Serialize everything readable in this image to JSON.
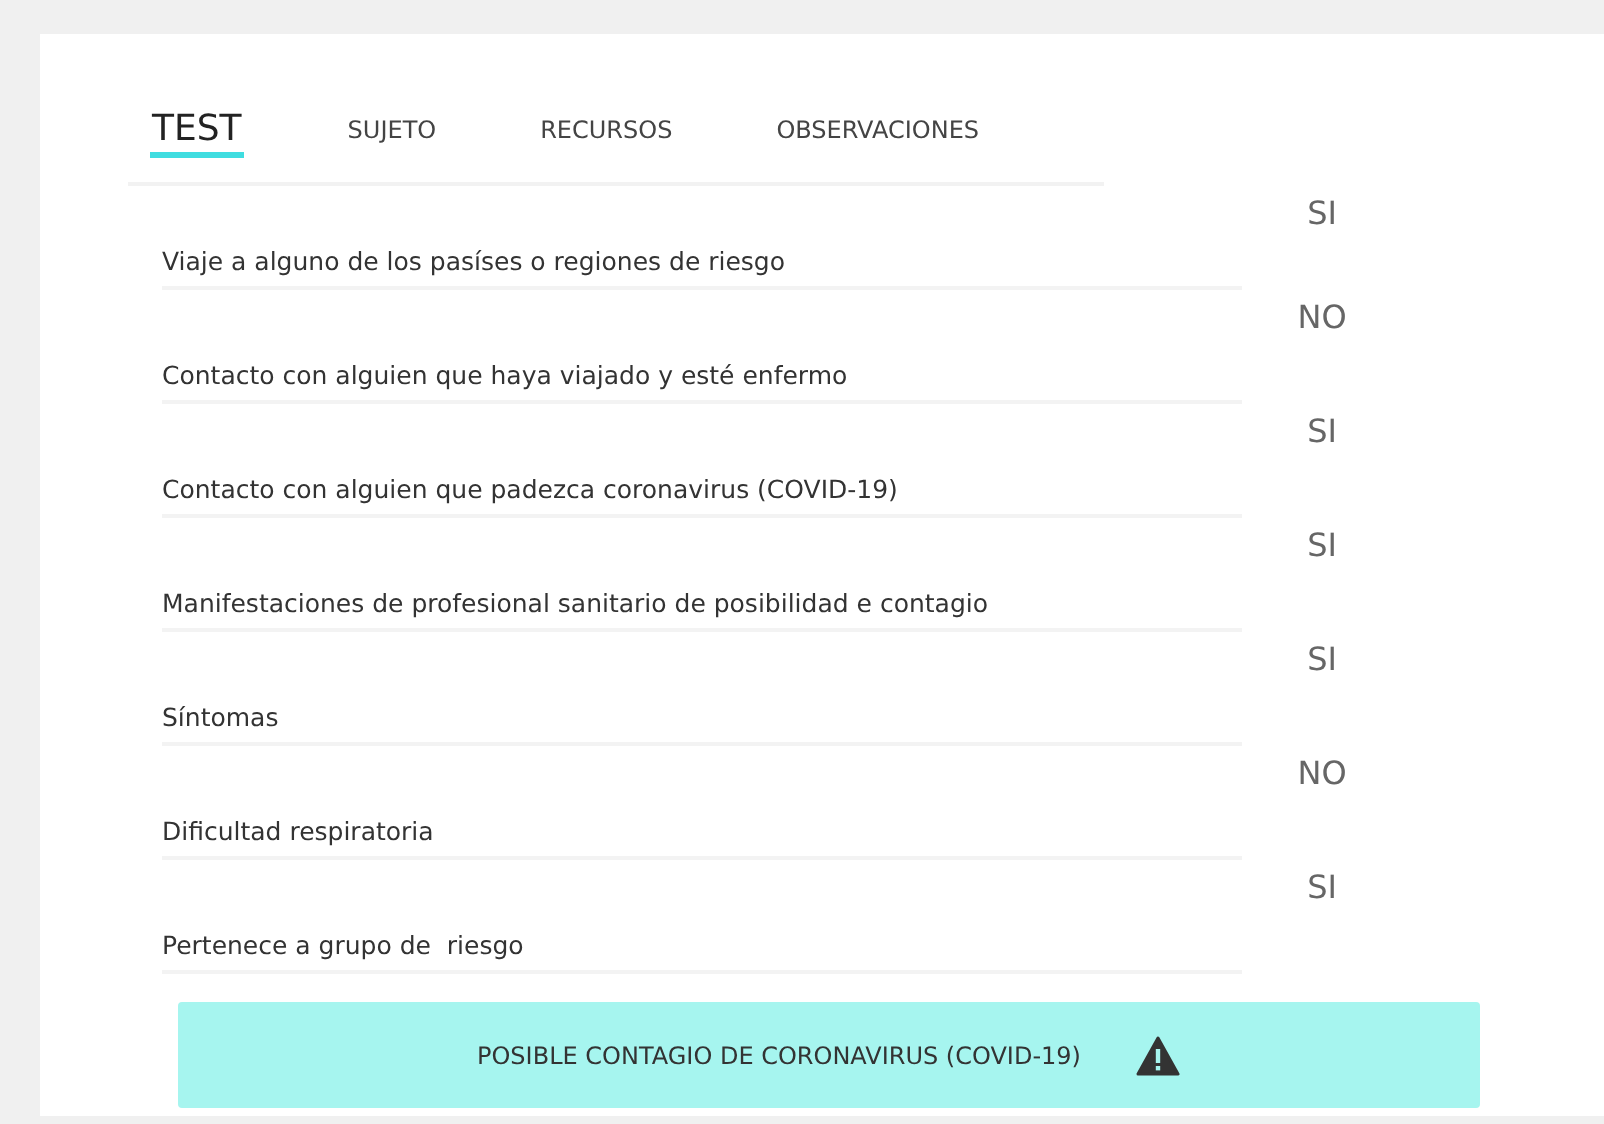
{
  "tabs": [
    {
      "label": "TEST",
      "selected": true
    },
    {
      "label": "SUJETO",
      "selected": false
    },
    {
      "label": "RECURSOS",
      "selected": false
    },
    {
      "label": "OBSERVACIONES",
      "selected": false
    }
  ],
  "questions": [
    {
      "question": "Viaje a alguno de los pasíses o regiones de riesgo",
      "answer": "SI"
    },
    {
      "question": "Contacto con alguien que haya viajado y esté enfermo",
      "answer": "NO"
    },
    {
      "question": "Contacto con alguien que padezca coronavirus (COVID-19)",
      "answer": "SI"
    },
    {
      "question": "Manifestaciones de profesional sanitario de posibilidad e contagio",
      "answer": "SI"
    },
    {
      "question": "Síntomas",
      "answer": "SI"
    },
    {
      "question": "Dificultad respiratoria",
      "answer": "NO"
    },
    {
      "question": "Pertenece a grupo de  riesgo",
      "answer": "SI"
    }
  ],
  "alert": {
    "text": "POSIBLE CONTAGIO DE CORONAVIRUS (COVID-19)"
  }
}
